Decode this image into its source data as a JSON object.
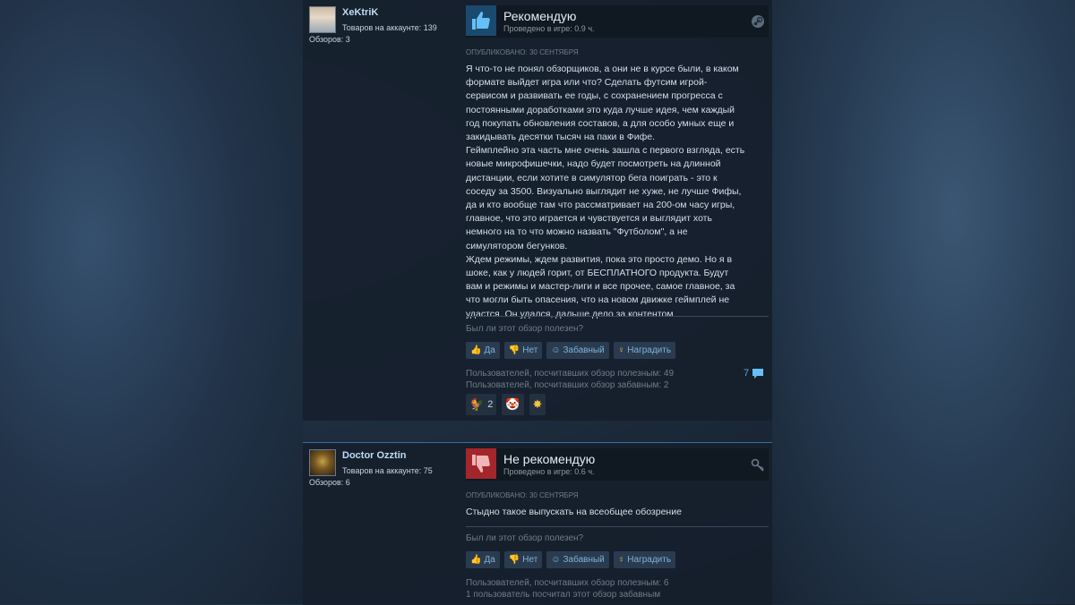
{
  "reviews": [
    {
      "author": {
        "name": "XeKtriK",
        "games_label": "Товаров на аккаунте: 139",
        "reviews_label": "Обзоров: 3"
      },
      "verdict": "Рекомендую",
      "hours": "Проведено в игре: 0.9 ч.",
      "platform_icon": "steam-icon",
      "posted": "ОПУБЛИКОВАНО: 30 СЕНТЯБРЯ",
      "text_lines": [
        "Я что-то не понял обзорщиков, а они не в курсе были, в каком",
        "формате выйдет игра или что? Сделать футсим игрой-",
        "сервисом и развивать ее годы, с сохранением прогресса с",
        "постоянными доработками это куда лучше идея, чем каждый",
        "год покупать обновления составов, а для особо умных еще и",
        "закидывать десятки тысяч на паки в Фифе.",
        "Геймплейно эта часть мне очень зашла с первого взгляда, есть",
        "новые микрофишечки, надо будет посмотреть на длинной",
        "дистанции, если хотите в симулятор бега поиграть - это к",
        "соседу за 3500. Визуально выглядит не хуже, не лучше Фифы,",
        "да и кто вообще там что рассматривает на 200-ом часу игры,",
        "главное, что это играется и чувствуется и выглядит хоть",
        "немного на то что можно назвать \"Футболом\", а не",
        "симулятором бегунков.",
        "Ждем режимы, ждем развития, пока это просто демо. Но я в",
        "шоке, как у людей горит, от БЕСПЛАТНОГО продукта. Будут",
        "вам и режимы и мастер-лиги и все прочее, самое главное, за",
        "что могли быть опасения, что на новом движке геймплей не",
        "удастся. Он удался, дальше дело за контентом"
      ],
      "helpful_question": "Был ли этот обзор полезен?",
      "buttons": {
        "yes": "Да",
        "no": "Нет",
        "funny": "Забавный",
        "award": "Наградить"
      },
      "stats": [
        "Пользователей, посчитавших обзор полезным: 49",
        "Пользователей, посчитавших обзор забавным: 2"
      ],
      "comments": "7",
      "awards": [
        {
          "icon": "rooster-icon",
          "count": "2"
        },
        {
          "icon": "clown-icon",
          "count": ""
        },
        {
          "icon": "sparkle-icon",
          "count": ""
        }
      ]
    },
    {
      "author": {
        "name": "Doctor Ozztin",
        "games_label": "Товаров на аккаунте: 75",
        "reviews_label": "Обзоров: 6"
      },
      "verdict": "Не рекомендую",
      "hours": "Проведено в игре: 0.6 ч.",
      "platform_icon": "key-icon",
      "posted": "ОПУБЛИКОВАНО: 30 СЕНТЯБРЯ",
      "text_lines": [
        "Стыдно такое выпускать на всеобщее обозрение"
      ],
      "helpful_question": "Был ли этот обзор полезен?",
      "buttons": {
        "yes": "Да",
        "no": "Нет",
        "funny": "Забавный",
        "award": "Наградить"
      },
      "stats": [
        "Пользователей, посчитавших обзор полезным: 6",
        "1 пользователь посчитал этот обзор забавным"
      ]
    }
  ]
}
